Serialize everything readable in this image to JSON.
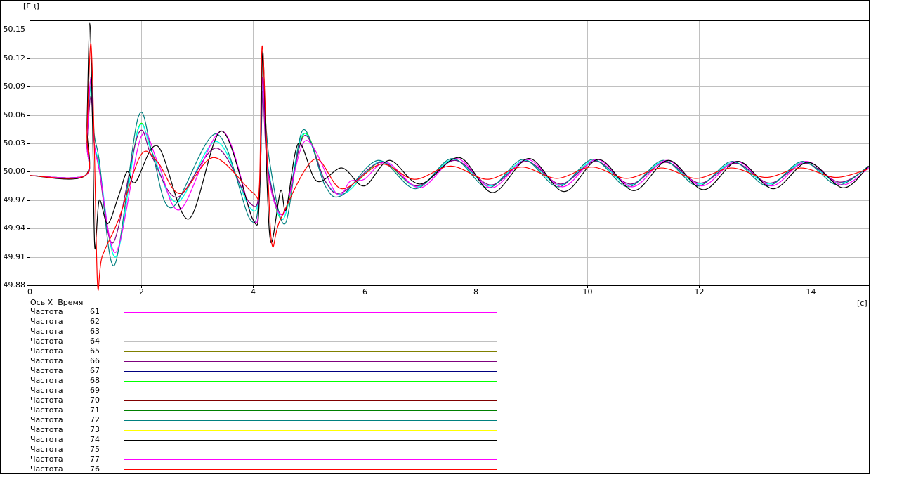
{
  "chart_data": {
    "type": "line",
    "ylabel": "[Гц]",
    "xlabel_unit": "[c]",
    "x_axis_title": "Ось X  Время",
    "xlim": [
      0,
      15.04
    ],
    "ylim": [
      49.88,
      50.16
    ],
    "grid": true,
    "x_ticks": [
      "0",
      "2",
      "4",
      "6",
      "8",
      "10",
      "12",
      "14"
    ],
    "x_tick_values": [
      0,
      2,
      4,
      6,
      8,
      10,
      12,
      14
    ],
    "y_ticks": [
      "50.15",
      "50.12",
      "50.09",
      "50.06",
      "50.03",
      "50.00",
      "49.97",
      "49.94",
      "49.91",
      "49.88"
    ],
    "y_tick_values": [
      50.15,
      50.12,
      50.09,
      50.06,
      50.03,
      50.0,
      49.97,
      49.94,
      49.91,
      49.88
    ],
    "series": [
      {
        "name": "Частота 68",
        "color": "#00ff00",
        "points": [
          [
            0,
            49.996
          ],
          [
            1.0,
            49.996
          ],
          [
            1.03,
            50.03
          ],
          [
            1.1,
            50.09
          ],
          [
            1.16,
            50.03
          ],
          [
            1.25,
            50.005
          ],
          [
            1.55,
            49.91
          ],
          [
            1.95,
            50.046
          ],
          [
            2.2,
            50.02
          ],
          [
            2.65,
            49.968
          ],
          [
            3.35,
            50.032
          ],
          [
            3.95,
            49.962
          ],
          [
            4.12,
            49.98
          ],
          [
            4.18,
            50.09
          ],
          [
            4.27,
            50.005
          ],
          [
            4.55,
            49.95
          ],
          [
            4.92,
            50.04
          ],
          [
            5.3,
            49.99
          ],
          [
            5.65,
            49.977
          ],
          [
            6.3,
            50.01
          ],
          [
            6.95,
            49.984
          ],
          [
            7.6,
            50.013
          ],
          [
            8.25,
            49.985
          ],
          [
            8.88,
            50.012
          ],
          [
            9.5,
            49.986
          ],
          [
            10.13,
            50.012
          ],
          [
            10.75,
            49.986
          ],
          [
            11.38,
            50.011
          ],
          [
            12.0,
            49.987
          ],
          [
            12.63,
            50.01
          ],
          [
            13.25,
            49.987
          ],
          [
            13.88,
            50.01
          ],
          [
            14.5,
            49.988
          ],
          [
            15.04,
            50.005
          ]
        ]
      },
      {
        "name": "Частота 69",
        "color": "#00ffff",
        "points": [
          [
            0,
            49.996
          ],
          [
            1.0,
            49.996
          ],
          [
            1.03,
            50.03
          ],
          [
            1.1,
            50.09
          ],
          [
            1.16,
            50.03
          ],
          [
            1.25,
            50.008
          ],
          [
            1.55,
            49.91
          ],
          [
            1.95,
            50.045
          ],
          [
            2.2,
            50.02
          ],
          [
            2.65,
            49.968
          ],
          [
            3.35,
            50.032
          ],
          [
            3.95,
            49.962
          ],
          [
            4.12,
            49.98
          ],
          [
            4.18,
            50.09
          ],
          [
            4.27,
            50.008
          ],
          [
            4.55,
            49.95
          ],
          [
            4.9,
            50.04
          ],
          [
            5.3,
            49.99
          ],
          [
            5.65,
            49.977
          ],
          [
            6.3,
            50.011
          ],
          [
            6.95,
            49.984
          ],
          [
            7.6,
            50.013
          ],
          [
            8.25,
            49.985
          ],
          [
            8.88,
            50.012
          ],
          [
            9.5,
            49.986
          ],
          [
            10.13,
            50.012
          ],
          [
            10.75,
            49.986
          ],
          [
            11.38,
            50.011
          ],
          [
            12.0,
            49.987
          ],
          [
            12.63,
            50.01
          ],
          [
            13.25,
            49.987
          ],
          [
            13.88,
            50.01
          ],
          [
            14.5,
            49.988
          ],
          [
            15.04,
            50.005
          ]
        ]
      },
      {
        "name": "Частота 66",
        "color": "#800080",
        "points": [
          [
            0,
            49.996
          ],
          [
            1.0,
            49.996
          ],
          [
            1.03,
            50.03
          ],
          [
            1.1,
            50.08
          ],
          [
            1.16,
            50.03
          ],
          [
            1.25,
            50.002
          ],
          [
            1.5,
            49.925
          ],
          [
            1.95,
            50.04
          ],
          [
            2.2,
            50.015
          ],
          [
            2.65,
            49.973
          ],
          [
            3.35,
            50.025
          ],
          [
            3.95,
            49.967
          ],
          [
            4.12,
            49.98
          ],
          [
            4.18,
            50.08
          ],
          [
            4.27,
            50.004
          ],
          [
            4.55,
            49.955
          ],
          [
            4.92,
            50.038
          ],
          [
            5.3,
            49.99
          ],
          [
            5.6,
            49.978
          ],
          [
            6.3,
            50.01
          ],
          [
            6.95,
            49.985
          ],
          [
            7.62,
            50.012
          ],
          [
            8.27,
            49.986
          ],
          [
            8.9,
            50.011
          ],
          [
            9.52,
            49.987
          ],
          [
            10.15,
            50.011
          ],
          [
            10.77,
            49.987
          ],
          [
            11.4,
            50.01
          ],
          [
            12.02,
            49.988
          ],
          [
            12.65,
            50.009
          ],
          [
            13.27,
            49.988
          ],
          [
            13.9,
            50.009
          ],
          [
            14.52,
            49.989
          ],
          [
            15.04,
            50.005
          ]
        ]
      },
      {
        "name": "Частота 72",
        "color": "#008080",
        "points": [
          [
            0,
            49.996
          ],
          [
            1.0,
            49.996
          ],
          [
            1.03,
            50.03
          ],
          [
            1.1,
            50.1
          ],
          [
            1.16,
            50.04
          ],
          [
            1.25,
            50.012
          ],
          [
            1.52,
            49.901
          ],
          [
            1.95,
            50.058
          ],
          [
            2.2,
            50.02
          ],
          [
            2.55,
            49.962
          ],
          [
            3.35,
            50.04
          ],
          [
            3.95,
            49.95
          ],
          [
            4.12,
            49.975
          ],
          [
            4.18,
            50.085
          ],
          [
            4.3,
            50.012
          ],
          [
            4.58,
            49.945
          ],
          [
            4.9,
            50.044
          ],
          [
            5.3,
            49.985
          ],
          [
            5.6,
            49.975
          ],
          [
            6.25,
            50.012
          ],
          [
            6.92,
            49.982
          ],
          [
            7.58,
            50.014
          ],
          [
            8.22,
            49.983
          ],
          [
            8.85,
            50.013
          ],
          [
            9.48,
            49.984
          ],
          [
            10.1,
            50.013
          ],
          [
            10.73,
            49.984
          ],
          [
            11.36,
            50.012
          ],
          [
            11.98,
            49.985
          ],
          [
            12.6,
            50.011
          ],
          [
            13.23,
            49.985
          ],
          [
            13.86,
            50.011
          ],
          [
            14.48,
            49.986
          ],
          [
            15.04,
            50.006
          ]
        ]
      },
      {
        "name": "Частота 61",
        "color": "#ff00ff",
        "points": [
          [
            0,
            49.996
          ],
          [
            1.0,
            49.996
          ],
          [
            1.03,
            50.03
          ],
          [
            1.1,
            50.1
          ],
          [
            1.16,
            50.03
          ],
          [
            1.25,
            50.003
          ],
          [
            1.55,
            49.915
          ],
          [
            2.0,
            50.037
          ],
          [
            2.3,
            50.01
          ],
          [
            2.7,
            49.96
          ],
          [
            3.45,
            50.043
          ],
          [
            4.0,
            49.95
          ],
          [
            4.12,
            49.975
          ],
          [
            4.18,
            50.1
          ],
          [
            4.27,
            50.0
          ],
          [
            4.55,
            49.955
          ],
          [
            4.95,
            50.033
          ],
          [
            5.5,
            49.977
          ],
          [
            5.75,
            49.99
          ],
          [
            6.0,
            49.992
          ],
          [
            6.4,
            50.01
          ],
          [
            7.0,
            49.983
          ],
          [
            7.65,
            50.014
          ],
          [
            8.28,
            49.983
          ],
          [
            8.92,
            50.013
          ],
          [
            9.55,
            49.984
          ],
          [
            10.17,
            50.013
          ],
          [
            10.8,
            49.984
          ],
          [
            11.42,
            50.012
          ],
          [
            12.05,
            49.985
          ],
          [
            12.67,
            50.011
          ],
          [
            13.3,
            49.985
          ],
          [
            13.92,
            50.011
          ],
          [
            14.55,
            49.986
          ],
          [
            15.04,
            50.004
          ]
        ]
      },
      {
        "name": "Частота 74",
        "color": "#000000",
        "points": [
          [
            0,
            49.996
          ],
          [
            1.0,
            49.996
          ],
          [
            1.03,
            50.05
          ],
          [
            1.08,
            50.157
          ],
          [
            1.13,
            50.05
          ],
          [
            1.17,
            49.92
          ],
          [
            1.25,
            49.97
          ],
          [
            1.4,
            49.945
          ],
          [
            1.6,
            49.975
          ],
          [
            1.75,
            50.0
          ],
          [
            1.9,
            49.989
          ],
          [
            2.3,
            50.027
          ],
          [
            2.85,
            49.95
          ],
          [
            3.44,
            50.043
          ],
          [
            4.0,
            49.95
          ],
          [
            4.12,
            49.97
          ],
          [
            4.18,
            50.127
          ],
          [
            4.25,
            50.0
          ],
          [
            4.33,
            49.925
          ],
          [
            4.5,
            49.98
          ],
          [
            4.6,
            49.96
          ],
          [
            4.82,
            50.03
          ],
          [
            5.15,
            49.99
          ],
          [
            5.6,
            50.004
          ],
          [
            6.0,
            49.985
          ],
          [
            6.45,
            50.012
          ],
          [
            7.0,
            49.987
          ],
          [
            7.7,
            50.015
          ],
          [
            8.3,
            49.978
          ],
          [
            8.95,
            50.014
          ],
          [
            9.58,
            49.979
          ],
          [
            10.2,
            50.013
          ],
          [
            10.83,
            49.98
          ],
          [
            11.45,
            50.012
          ],
          [
            12.08,
            49.981
          ],
          [
            12.7,
            50.011
          ],
          [
            13.33,
            49.982
          ],
          [
            13.95,
            50.01
          ],
          [
            14.58,
            49.983
          ],
          [
            15.04,
            50.006
          ]
        ]
      },
      {
        "name": "Частота 62",
        "color": "#ff0000",
        "points": [
          [
            0,
            49.996
          ],
          [
            1.0,
            49.996
          ],
          [
            1.03,
            50.04
          ],
          [
            1.1,
            50.136
          ],
          [
            1.16,
            50.03
          ],
          [
            1.22,
            49.88
          ],
          [
            1.3,
            49.91
          ],
          [
            1.6,
            49.95
          ],
          [
            2.0,
            50.018
          ],
          [
            2.3,
            50.01
          ],
          [
            2.7,
            49.977
          ],
          [
            3.3,
            50.015
          ],
          [
            4.0,
            49.978
          ],
          [
            4.12,
            49.985
          ],
          [
            4.17,
            50.133
          ],
          [
            4.27,
            50.0
          ],
          [
            4.35,
            49.922
          ],
          [
            4.5,
            49.95
          ],
          [
            5.1,
            50.013
          ],
          [
            5.6,
            49.982
          ],
          [
            6.3,
            50.008
          ],
          [
            6.9,
            49.992
          ],
          [
            7.55,
            50.006
          ],
          [
            8.2,
            49.992
          ],
          [
            8.82,
            50.005
          ],
          [
            9.45,
            49.993
          ],
          [
            10.08,
            50.005
          ],
          [
            10.7,
            49.993
          ],
          [
            11.33,
            50.004
          ],
          [
            11.95,
            49.993
          ],
          [
            12.58,
            50.004
          ],
          [
            13.2,
            49.994
          ],
          [
            13.83,
            50.004
          ],
          [
            14.45,
            49.994
          ],
          [
            15.04,
            50.003
          ]
        ]
      }
    ]
  },
  "legend": [
    {
      "label": "Частота",
      "id": "61",
      "color": "#ff00ff"
    },
    {
      "label": "Частота",
      "id": "62",
      "color": "#ff0000"
    },
    {
      "label": "Частота",
      "id": "63",
      "color": "#0000ff"
    },
    {
      "label": "Частота",
      "id": "64",
      "color": "#c0c0c0"
    },
    {
      "label": "Частота",
      "id": "65",
      "color": "#808000"
    },
    {
      "label": "Частота",
      "id": "66",
      "color": "#800080"
    },
    {
      "label": "Частота",
      "id": "67",
      "color": "#000080"
    },
    {
      "label": "Частота",
      "id": "68",
      "color": "#00ff00"
    },
    {
      "label": "Частота",
      "id": "69",
      "color": "#00ffff"
    },
    {
      "label": "Частота",
      "id": "70",
      "color": "#800000"
    },
    {
      "label": "Частота",
      "id": "71",
      "color": "#008000"
    },
    {
      "label": "Частота",
      "id": "72",
      "color": "#008080"
    },
    {
      "label": "Частота",
      "id": "73",
      "color": "#ffff00"
    },
    {
      "label": "Частота",
      "id": "74",
      "color": "#000000"
    },
    {
      "label": "Частота",
      "id": "75",
      "color": "#808080"
    },
    {
      "label": "Частота",
      "id": "77",
      "color": "#ff00ff"
    },
    {
      "label": "Частота",
      "id": "76",
      "color": "#ff0000"
    }
  ]
}
